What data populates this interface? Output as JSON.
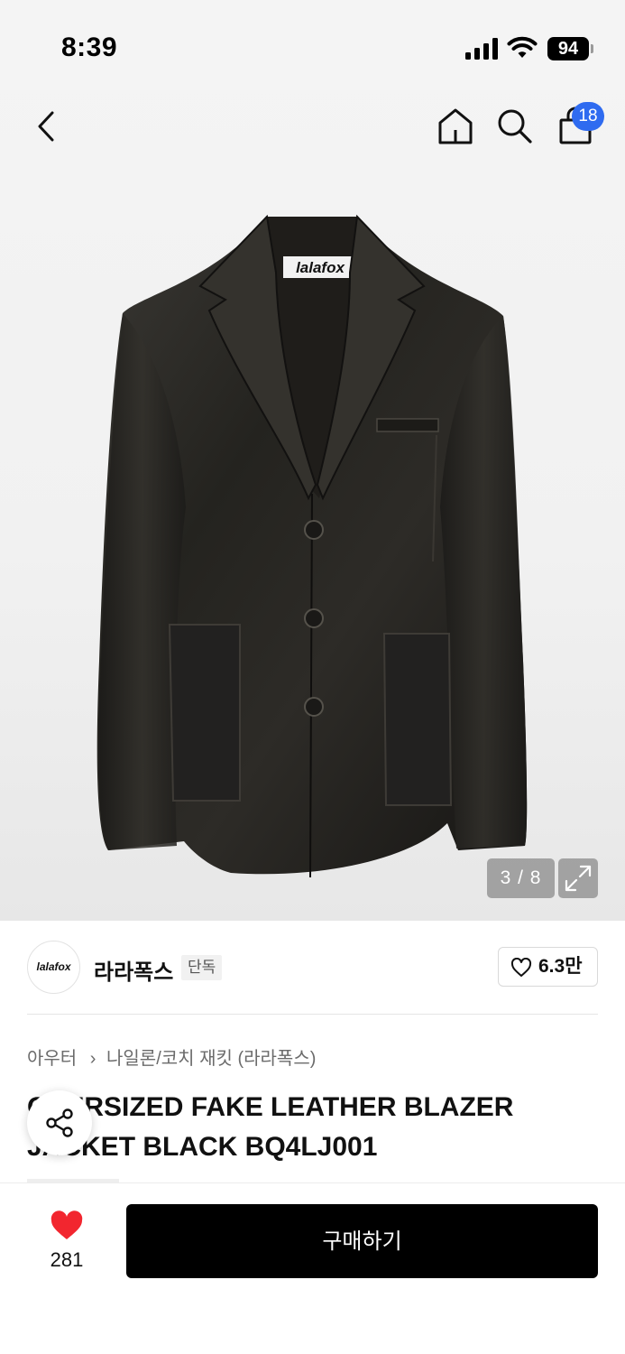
{
  "status_bar": {
    "time": "8:39",
    "battery": "94"
  },
  "header": {
    "cart_count": "18"
  },
  "gallery": {
    "image_label": "lalafox",
    "pager": "3 / 8"
  },
  "brand": {
    "logo_text": "lalafox",
    "name": "라라폭스",
    "tag": "단독",
    "likes": "6.3만"
  },
  "breadcrumb": {
    "category": "아우터",
    "subcategory": "나일론/코치 재킷 (라라폭스)"
  },
  "product": {
    "name": "OVERSIZED FAKE LEATHER BLAZER JACKET BLACK BQ4LJ001"
  },
  "bottom": {
    "wish_count": "281",
    "buy_label": "구매하기"
  },
  "colors": {
    "accent_badge": "#2f6bf0",
    "wish_heart": "#f2262f",
    "buy_button": "#000000"
  },
  "icons": [
    "back-icon",
    "home-icon",
    "search-icon",
    "cart-icon",
    "expand-icon",
    "heart-outline-icon",
    "share-icon",
    "heart-filled-icon"
  ]
}
